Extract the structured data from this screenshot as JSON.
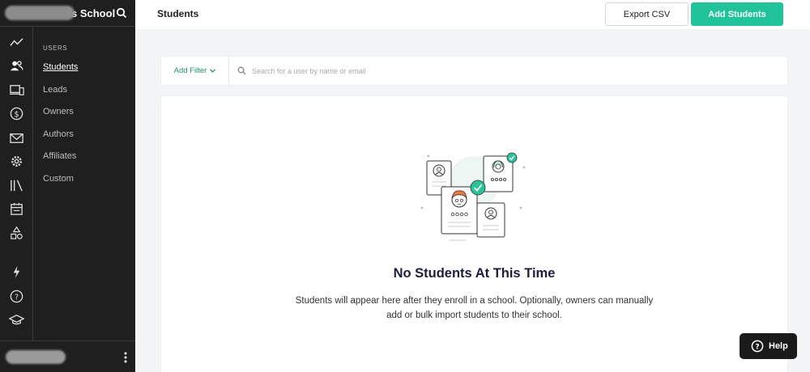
{
  "sidebar": {
    "school_name": "s School",
    "section_title": "USERS",
    "items": [
      {
        "label": "Students",
        "active": true
      },
      {
        "label": "Leads"
      },
      {
        "label": "Owners"
      },
      {
        "label": "Authors"
      },
      {
        "label": "Affiliates"
      },
      {
        "label": "Custom"
      }
    ],
    "rail_icons": [
      "analytics-icon",
      "users-icon",
      "devices-icon",
      "dollar-icon",
      "mail-icon",
      "gear-icon",
      "library-icon",
      "calendar-icon",
      "shapes-icon",
      "lightning-icon",
      "help-circle-icon",
      "graduation-cap-icon"
    ]
  },
  "header": {
    "title": "Students",
    "export_label": "Export CSV",
    "add_label": "Add Students"
  },
  "filter": {
    "add_filter_label": "Add Filter",
    "search_placeholder": "Search for a user by name or email",
    "search_value": ""
  },
  "empty_state": {
    "title": "No Students At This Time",
    "line1": "Students will appear here after they enroll in a school. Optionally, owners can manually",
    "line2": "add or bulk import students to their school."
  },
  "help": {
    "label": "Help"
  },
  "colors": {
    "accent": "#21c49a",
    "sidebar": "#1f1f1f",
    "filter_link": "#1c8f6c"
  }
}
